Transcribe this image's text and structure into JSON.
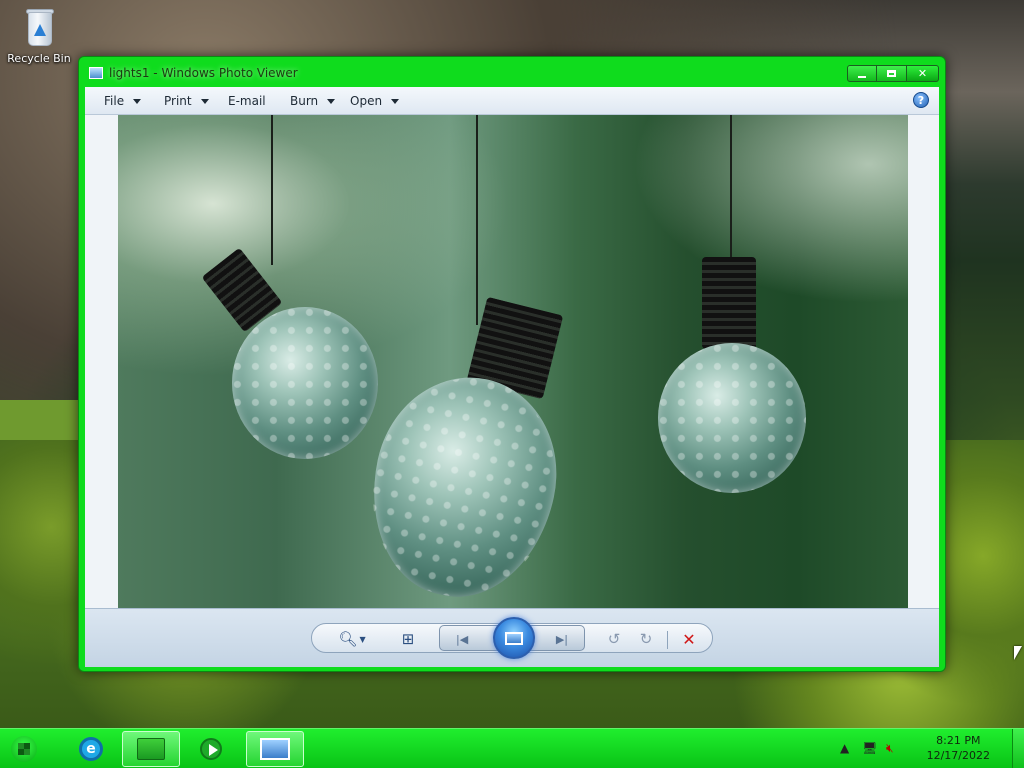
{
  "desktop": {
    "icons": [
      {
        "label": "Recycle Bin",
        "icon": "recycle-bin-icon"
      }
    ]
  },
  "window": {
    "title": "lights1 - Windows Photo Viewer",
    "accent_color": "#0fdc1d",
    "caption_buttons": {
      "minimize": "minimize",
      "maximize": "maximize",
      "close": "close"
    },
    "menus": [
      {
        "label": "File",
        "has_dropdown": true
      },
      {
        "label": "Print",
        "has_dropdown": true
      },
      {
        "label": "E-mail",
        "has_dropdown": false
      },
      {
        "label": "Burn",
        "has_dropdown": true
      },
      {
        "label": "Open",
        "has_dropdown": true
      }
    ],
    "help_icon": "help-icon",
    "image": {
      "subject": "three hanging light bulbs with water droplets"
    },
    "controls": [
      {
        "name": "zoom",
        "icon": "zoom-icon"
      },
      {
        "name": "actual-size",
        "icon": "fit-to-window-icon"
      },
      {
        "name": "previous",
        "icon": "previous-icon"
      },
      {
        "name": "slideshow",
        "icon": "slideshow-icon"
      },
      {
        "name": "next",
        "icon": "next-icon"
      },
      {
        "name": "rotate-counterclockwise",
        "icon": "rotate-left-icon"
      },
      {
        "name": "rotate-clockwise",
        "icon": "rotate-right-icon"
      },
      {
        "name": "delete",
        "icon": "delete-icon",
        "color": "#d01818"
      }
    ]
  },
  "taskbar": {
    "color": "#10c81c",
    "items": [
      {
        "name": "start",
        "icon": "windows-start-icon"
      },
      {
        "name": "internet-explorer",
        "icon": "internet-explorer-icon"
      },
      {
        "name": "windows-explorer",
        "icon": "folder-icon",
        "active": true
      },
      {
        "name": "media-player",
        "icon": "media-player-icon"
      },
      {
        "name": "photo-viewer",
        "icon": "photo-viewer-icon",
        "active": true
      }
    ],
    "tray": {
      "icons": [
        "show-hidden-icons-icon",
        "network-icon",
        "volume-muted-icon"
      ],
      "time": "8:21 PM",
      "date": "12/17/2022"
    }
  }
}
